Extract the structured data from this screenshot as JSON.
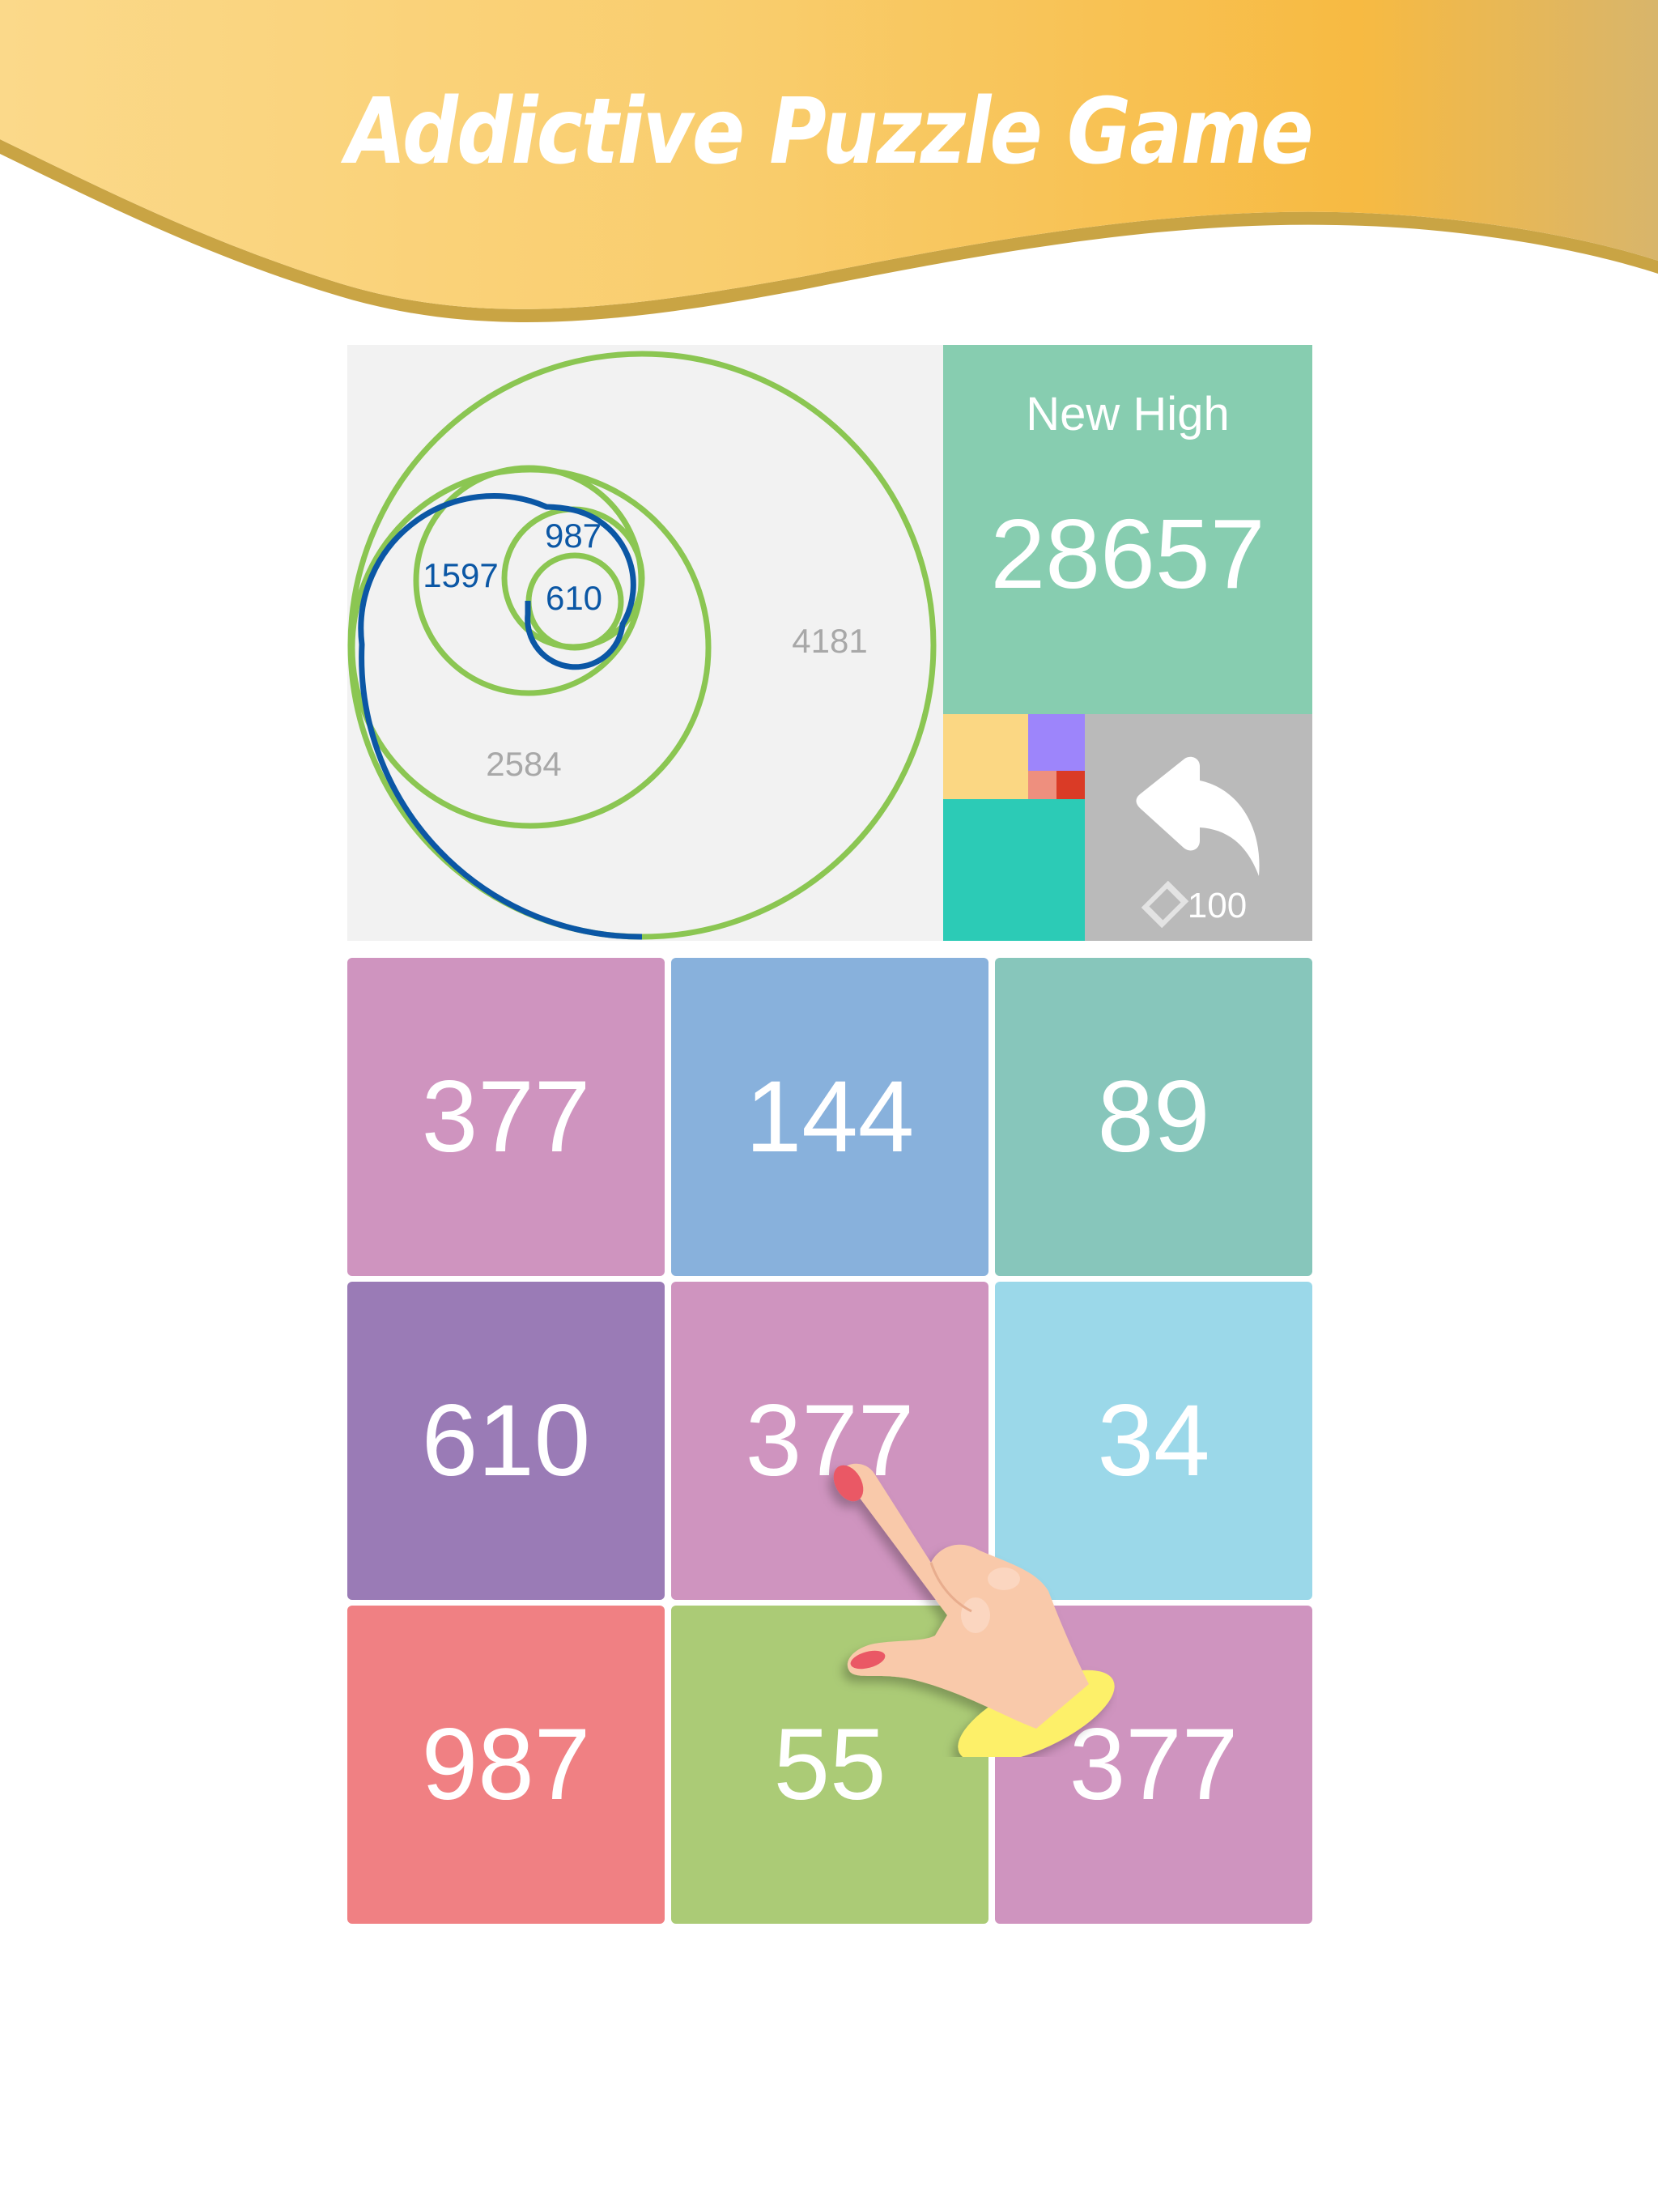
{
  "banner": {
    "title": "Addictive Puzzle Game",
    "gradient_colors": [
      "#fbd98a",
      "#f8bd45",
      "#d8b56b"
    ],
    "edge_color": "#c9a444"
  },
  "spiral": {
    "background": "#f2f2f2",
    "circle_color": "#8bc652",
    "spiral_color": "#0b57a5",
    "labels": [
      {
        "text": "987",
        "style": "blue"
      },
      {
        "text": "1597",
        "style": "blue"
      },
      {
        "text": "610",
        "style": "blue"
      },
      {
        "text": "4181",
        "style": "gray"
      },
      {
        "text": "2584",
        "style": "gray"
      }
    ]
  },
  "score": {
    "title": "New High",
    "value": "28657",
    "background": "#87cdb0"
  },
  "mini_blocks": [
    {
      "name": "yellow",
      "color": "#fbd783"
    },
    {
      "name": "purple",
      "color": "#9d85fb"
    },
    {
      "name": "salmon",
      "color": "#ee8f7e"
    },
    {
      "name": "red",
      "color": "#da3b26"
    },
    {
      "name": "teal",
      "color": "#2ccbb6"
    }
  ],
  "undo": {
    "icon": "undo-arrow-icon",
    "currency_icon": "diamond-icon",
    "cost": "100",
    "background": "#bababa"
  },
  "grid": {
    "rows": 3,
    "cols": 3,
    "tiles": [
      {
        "value": "377",
        "color": "#cf94bf"
      },
      {
        "value": "144",
        "color": "#88b1dc"
      },
      {
        "value": "89",
        "color": "#87c6bb"
      },
      {
        "value": "610",
        "color": "#9a7bb6"
      },
      {
        "value": "377",
        "color": "#cf94bf"
      },
      {
        "value": "34",
        "color": "#9bd8e9"
      },
      {
        "value": "987",
        "color": "#f08083"
      },
      {
        "value": "55",
        "color": "#abcb76"
      },
      {
        "value": "377",
        "color": "#cf94bf"
      }
    ]
  },
  "hand_pointer": {
    "icon": "hand-pointer-icon",
    "skin_color": "#f9c9aa",
    "nail_color": "#ea5865",
    "cuff_color": "#fdf069"
  }
}
